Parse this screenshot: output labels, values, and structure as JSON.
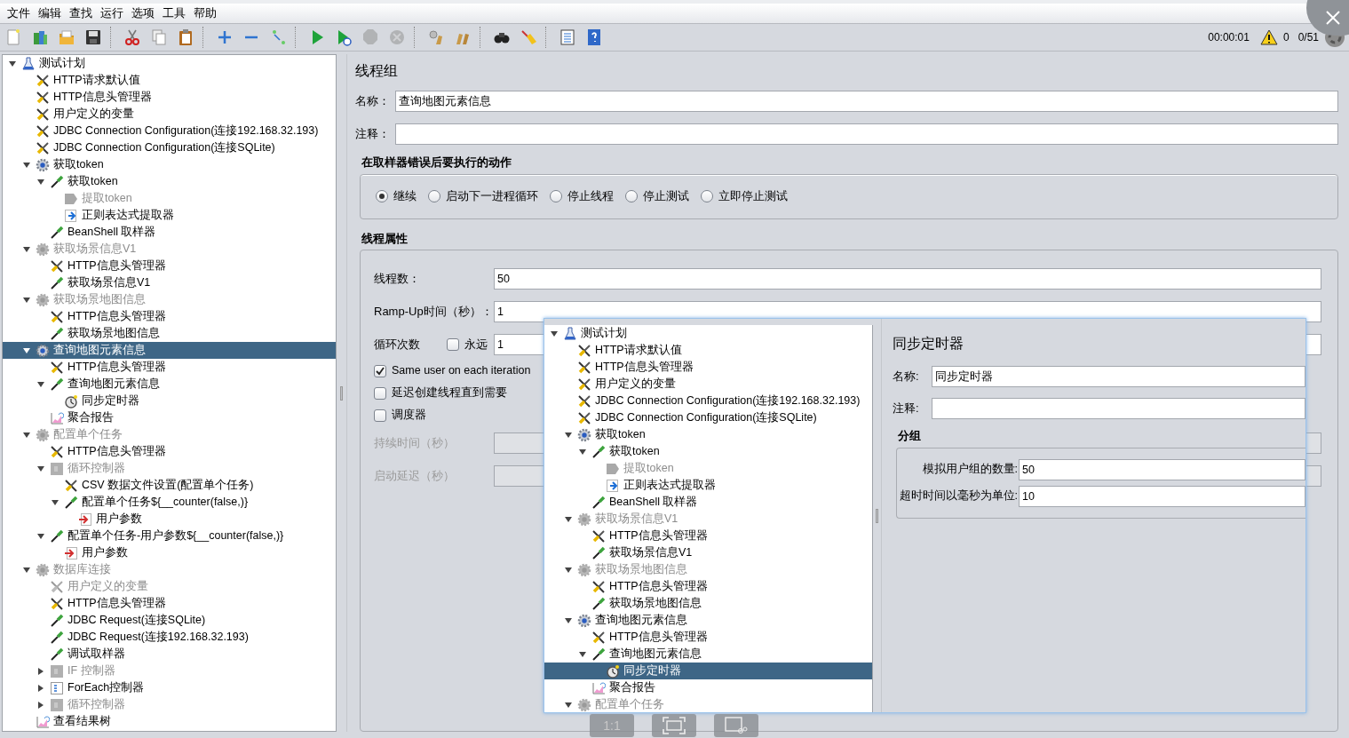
{
  "menu": [
    "文件",
    "编辑",
    "查找",
    "运行",
    "选项",
    "工具",
    "帮助"
  ],
  "toolbar": [
    [
      {
        "kind": "new",
        "disabled": false
      },
      {
        "kind": "templates",
        "disabled": false
      },
      {
        "kind": "open",
        "disabled": false
      },
      {
        "kind": "save",
        "disabled": false
      }
    ],
    [
      {
        "kind": "cut",
        "disabled": false
      },
      {
        "kind": "copy",
        "disabled": false
      },
      {
        "kind": "paste",
        "disabled": false
      }
    ],
    [
      {
        "kind": "expand",
        "disabled": false
      },
      {
        "kind": "collapse",
        "disabled": false
      },
      {
        "kind": "toggle",
        "disabled": false
      }
    ],
    [
      {
        "kind": "start",
        "disabled": false
      },
      {
        "kind": "start-no-pauses",
        "disabled": false
      },
      {
        "kind": "stop",
        "disabled": true
      },
      {
        "kind": "shutdown",
        "disabled": true
      }
    ],
    [
      {
        "kind": "clear",
        "disabled": false
      },
      {
        "kind": "clear-all",
        "disabled": false
      }
    ],
    [
      {
        "kind": "search",
        "disabled": false
      },
      {
        "kind": "reset-search",
        "disabled": false
      }
    ],
    [
      {
        "kind": "function-helper",
        "disabled": false
      },
      {
        "kind": "help",
        "disabled": false
      }
    ]
  ],
  "status": {
    "elapsed": "00:00:01",
    "warnings": "0",
    "threads": "0/51"
  },
  "tree": [
    {
      "label": "测试计划",
      "kind": "plan",
      "disabled": false,
      "selected": false,
      "expanded": true,
      "children": [
        {
          "label": "HTTP请求默认值",
          "kind": "config",
          "disabled": false,
          "selected": false
        },
        {
          "label": "HTTP信息头管理器",
          "kind": "config",
          "disabled": false,
          "selected": false
        },
        {
          "label": "用户定义的变量",
          "kind": "config",
          "disabled": false,
          "selected": false
        },
        {
          "label": "JDBC Connection Configuration(连接192.168.32.193)",
          "kind": "config",
          "disabled": false,
          "selected": false
        },
        {
          "label": "JDBC Connection Configuration(连接SQLite)",
          "kind": "config",
          "disabled": false,
          "selected": false
        },
        {
          "label": "获取token",
          "kind": "thread-group",
          "disabled": false,
          "selected": false,
          "expanded": true,
          "children": [
            {
              "label": "获取token",
              "kind": "sampler",
              "disabled": false,
              "selected": false,
              "expanded": true,
              "children": [
                {
                  "label": "提取token",
                  "kind": "post-processor",
                  "disabled": true,
                  "selected": false
                },
                {
                  "label": "正则表达式提取器",
                  "kind": "post-processor",
                  "disabled": false,
                  "selected": false
                }
              ]
            },
            {
              "label": "BeanShell 取样器",
              "kind": "sampler",
              "disabled": false,
              "selected": false
            }
          ]
        },
        {
          "label": "获取场景信息V1",
          "kind": "thread-group",
          "disabled": true,
          "selected": false,
          "expanded": true,
          "children": [
            {
              "label": "HTTP信息头管理器",
              "kind": "config",
              "disabled": false,
              "selected": false
            },
            {
              "label": "获取场景信息V1",
              "kind": "sampler",
              "disabled": false,
              "selected": false
            }
          ]
        },
        {
          "label": "获取场景地图信息",
          "kind": "thread-group",
          "disabled": true,
          "selected": false,
          "expanded": true,
          "children": [
            {
              "label": "HTTP信息头管理器",
              "kind": "config",
              "disabled": false,
              "selected": false
            },
            {
              "label": "获取场景地图信息",
              "kind": "sampler",
              "disabled": false,
              "selected": false
            }
          ]
        },
        {
          "label": "查询地图元素信息",
          "kind": "thread-group",
          "disabled": false,
          "selected": true,
          "expanded": true,
          "children": [
            {
              "label": "HTTP信息头管理器",
              "kind": "config",
              "disabled": false,
              "selected": false
            },
            {
              "label": "查询地图元素信息",
              "kind": "sampler",
              "disabled": false,
              "selected": false,
              "expanded": true,
              "children": [
                {
                  "label": "同步定时器",
                  "kind": "timer",
                  "disabled": false,
                  "selected": false
                }
              ]
            },
            {
              "label": "聚合报告",
              "kind": "listener",
              "disabled": false,
              "selected": false
            }
          ]
        },
        {
          "label": "配置单个任务",
          "kind": "thread-group",
          "disabled": true,
          "selected": false,
          "expanded": true,
          "children": [
            {
              "label": "HTTP信息头管理器",
              "kind": "config",
              "disabled": false,
              "selected": false
            },
            {
              "label": "循环控制器",
              "kind": "controller",
              "disabled": true,
              "selected": false,
              "expanded": true,
              "children": [
                {
                  "label": "CSV 数据文件设置(配置单个任务)",
                  "kind": "config",
                  "disabled": false,
                  "selected": false
                },
                {
                  "label": "配置单个任务${__counter(false,)}",
                  "kind": "sampler",
                  "disabled": false,
                  "selected": false,
                  "expanded": true,
                  "children": [
                    {
                      "label": "用户参数",
                      "kind": "pre-processor",
                      "disabled": false,
                      "selected": false
                    }
                  ]
                }
              ]
            },
            {
              "label": "配置单个任务-用户参数${__counter(false,)}",
              "kind": "sampler",
              "disabled": false,
              "selected": false,
              "expanded": true,
              "children": [
                {
                  "label": "用户参数",
                  "kind": "pre-processor",
                  "disabled": false,
                  "selected": false
                }
              ]
            }
          ]
        },
        {
          "label": "数据库连接",
          "kind": "thread-group",
          "disabled": true,
          "selected": false,
          "expanded": true,
          "children": [
            {
              "label": "用户定义的变量",
              "kind": "config",
              "disabled": true,
              "selected": false
            },
            {
              "label": "HTTP信息头管理器",
              "kind": "config",
              "disabled": false,
              "selected": false
            },
            {
              "label": "JDBC Request(连接SQLite)",
              "kind": "sampler",
              "disabled": false,
              "selected": false
            },
            {
              "label": "JDBC Request(连接192.168.32.193)",
              "kind": "sampler",
              "disabled": false,
              "selected": false
            },
            {
              "label": "调试取样器",
              "kind": "sampler",
              "disabled": false,
              "selected": false
            },
            {
              "label": "IF 控制器",
              "kind": "controller",
              "disabled": true,
              "selected": false,
              "expanded": false
            },
            {
              "label": "ForEach控制器",
              "kind": "foreach-controller",
              "disabled": false,
              "selected": false,
              "expanded": false
            },
            {
              "label": "循环控制器",
              "kind": "controller",
              "disabled": true,
              "selected": false,
              "expanded": false
            }
          ]
        },
        {
          "label": "查看结果树",
          "kind": "listener",
          "disabled": false,
          "selected": false
        }
      ]
    }
  ],
  "thread_group": {
    "title": "线程组",
    "name_label": "名称：",
    "name": "查询地图元素信息",
    "comment_label": "注释：",
    "error_action": {
      "title": "在取样器错误后要执行的动作",
      "options": [
        {
          "label": "继续",
          "selected": true
        },
        {
          "label": "启动下一进程循环",
          "selected": false
        },
        {
          "label": "停止线程",
          "selected": false
        },
        {
          "label": "停止测试",
          "selected": false
        },
        {
          "label": "立即停止测试",
          "selected": false
        }
      ]
    },
    "properties": {
      "title": "线程属性",
      "threads_label": "线程数：",
      "threads": "50",
      "rampup_label": "Ramp-Up时间（秒）：",
      "rampup": "1",
      "loop_label": "循环次数",
      "forever": {
        "label": "永远",
        "checked": false
      },
      "loops": "1",
      "options": [
        {
          "label": "Same user on each iteration",
          "checked": true
        },
        {
          "label": "延迟创建线程直到需要",
          "checked": false
        },
        {
          "label": "调度器",
          "checked": false
        }
      ],
      "duration_label": "持续时间（秒）",
      "delay_label": "启动延迟（秒）",
      "scheduler_fields_disabled": true
    }
  },
  "preview": {
    "tree": [
      {
        "label": "测试计划",
        "kind": "plan",
        "disabled": false,
        "selected": false,
        "expanded": true,
        "children": [
          {
            "label": "HTTP请求默认值",
            "kind": "config",
            "disabled": false,
            "selected": false
          },
          {
            "label": "HTTP信息头管理器",
            "kind": "config",
            "disabled": false,
            "selected": false
          },
          {
            "label": "用户定义的变量",
            "kind": "config",
            "disabled": false,
            "selected": false
          },
          {
            "label": "JDBC Connection Configuration(连接192.168.32.193)",
            "kind": "config",
            "disabled": false,
            "selected": false
          },
          {
            "label": "JDBC Connection Configuration(连接SQLite)",
            "kind": "config",
            "disabled": false,
            "selected": false
          },
          {
            "label": "获取token",
            "kind": "thread-group",
            "disabled": false,
            "selected": false,
            "expanded": true,
            "children": [
              {
                "label": "获取token",
                "kind": "sampler",
                "disabled": false,
                "selected": false,
                "expanded": true,
                "children": [
                  {
                    "label": "提取token",
                    "kind": "post-processor",
                    "disabled": true,
                    "selected": false
                  },
                  {
                    "label": "正则表达式提取器",
                    "kind": "post-processor",
                    "disabled": false,
                    "selected": false
                  }
                ]
              },
              {
                "label": "BeanShell 取样器",
                "kind": "sampler",
                "disabled": false,
                "selected": false
              }
            ]
          },
          {
            "label": "获取场景信息V1",
            "kind": "thread-group",
            "disabled": true,
            "selected": false,
            "expanded": true,
            "children": [
              {
                "label": "HTTP信息头管理器",
                "kind": "config",
                "disabled": false,
                "selected": false
              },
              {
                "label": "获取场景信息V1",
                "kind": "sampler",
                "disabled": false,
                "selected": false
              }
            ]
          },
          {
            "label": "获取场景地图信息",
            "kind": "thread-group",
            "disabled": true,
            "selected": false,
            "expanded": true,
            "children": [
              {
                "label": "HTTP信息头管理器",
                "kind": "config",
                "disabled": false,
                "selected": false
              },
              {
                "label": "获取场景地图信息",
                "kind": "sampler",
                "disabled": false,
                "selected": false
              }
            ]
          },
          {
            "label": "查询地图元素信息",
            "kind": "thread-group",
            "disabled": false,
            "selected": false,
            "expanded": true,
            "children": [
              {
                "label": "HTTP信息头管理器",
                "kind": "config",
                "disabled": false,
                "selected": false
              },
              {
                "label": "查询地图元素信息",
                "kind": "sampler",
                "disabled": false,
                "selected": false,
                "expanded": true,
                "children": [
                  {
                    "label": "同步定时器",
                    "kind": "timer",
                    "disabled": false,
                    "selected": true
                  }
                ]
              },
              {
                "label": "聚合报告",
                "kind": "listener",
                "disabled": false,
                "selected": false
              }
            ]
          },
          {
            "label": "配置单个任务",
            "kind": "thread-group",
            "disabled": true,
            "selected": false,
            "expanded": true
          }
        ]
      }
    ],
    "timer": {
      "title": "同步定时器",
      "name_label": "名称:",
      "name": "同步定时器",
      "comment_label": "注释:",
      "group_title": "分组",
      "users_label": "模拟用户组的数量:",
      "users": "50",
      "timeout_label": "超时时间以毫秒为单位:",
      "timeout": "10"
    },
    "view_buttons": [
      {
        "kind": "actual-size",
        "label": "1:1"
      },
      {
        "kind": "fit-screen"
      },
      {
        "kind": "crop"
      }
    ]
  }
}
